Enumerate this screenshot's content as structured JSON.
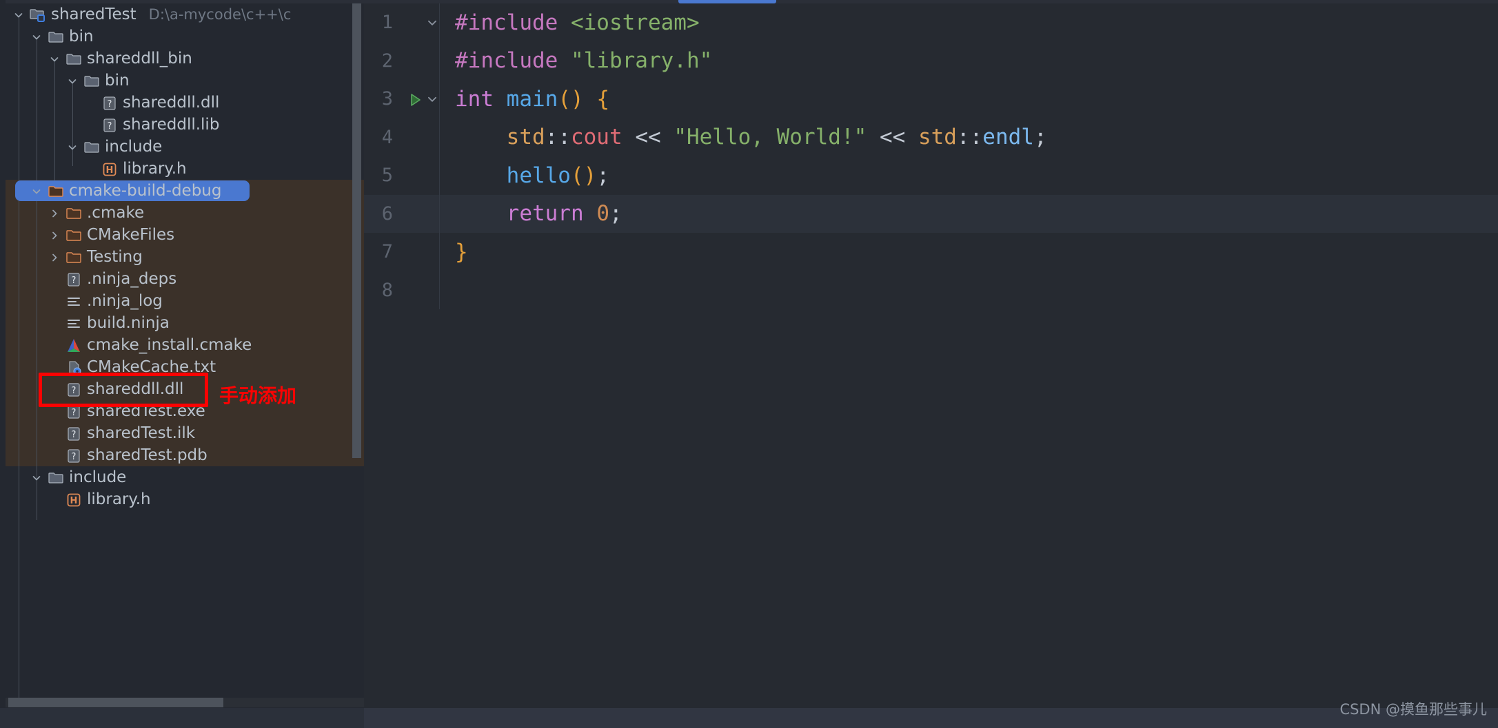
{
  "window": {
    "background": "#262a31",
    "accent": "#4a78d0",
    "excluded_background": "#3b3129",
    "annotation_color": "#fb0303"
  },
  "project_tree": {
    "root": {
      "label": "sharedTest",
      "path_hint": "D:\\a-mycode\\c++\\c",
      "icon": "project-module-folder-icon",
      "expanded": true
    },
    "nodes": [
      {
        "label": "sharedTest",
        "sublabel": "D:\\a-mycode\\c++\\c",
        "indent": 0,
        "type": "module",
        "icon": "project-module-folder-icon",
        "twisty": "down",
        "excluded": false,
        "selected": false
      },
      {
        "label": "bin",
        "sublabel": "",
        "indent": 1,
        "type": "folder",
        "icon": "folder-icon",
        "twisty": "down",
        "excluded": false,
        "selected": false
      },
      {
        "label": "shareddll_bin",
        "sublabel": "",
        "indent": 2,
        "type": "folder",
        "icon": "folder-icon",
        "twisty": "down",
        "excluded": false,
        "selected": false
      },
      {
        "label": "bin",
        "sublabel": "",
        "indent": 3,
        "type": "folder",
        "icon": "folder-icon",
        "twisty": "down",
        "excluded": false,
        "selected": false
      },
      {
        "label": "shareddll.dll",
        "sublabel": "",
        "indent": 4,
        "type": "file",
        "icon": "unknown-file-icon",
        "twisty": "none",
        "excluded": false,
        "selected": false
      },
      {
        "label": "shareddll.lib",
        "sublabel": "",
        "indent": 4,
        "type": "file",
        "icon": "unknown-file-icon",
        "twisty": "none",
        "excluded": false,
        "selected": false
      },
      {
        "label": "include",
        "sublabel": "",
        "indent": 3,
        "type": "folder",
        "icon": "folder-icon",
        "twisty": "down",
        "excluded": false,
        "selected": false
      },
      {
        "label": "library.h",
        "sublabel": "",
        "indent": 4,
        "type": "file",
        "icon": "header-file-icon",
        "twisty": "none",
        "excluded": false,
        "selected": false
      },
      {
        "label": "cmake-build-debug",
        "sublabel": "",
        "indent": 1,
        "type": "folder",
        "icon": "excluded-folder-icon",
        "twisty": "down",
        "excluded": true,
        "selected": true
      },
      {
        "label": ".cmake",
        "sublabel": "",
        "indent": 2,
        "type": "folder",
        "icon": "excluded-folder-icon",
        "twisty": "right",
        "excluded": true,
        "selected": false
      },
      {
        "label": "CMakeFiles",
        "sublabel": "",
        "indent": 2,
        "type": "folder",
        "icon": "excluded-folder-icon",
        "twisty": "right",
        "excluded": true,
        "selected": false
      },
      {
        "label": "Testing",
        "sublabel": "",
        "indent": 2,
        "type": "folder",
        "icon": "excluded-folder-icon",
        "twisty": "right",
        "excluded": true,
        "selected": false
      },
      {
        "label": ".ninja_deps",
        "sublabel": "",
        "indent": 2,
        "type": "file",
        "icon": "unknown-file-icon",
        "twisty": "none",
        "excluded": true,
        "selected": false
      },
      {
        "label": ".ninja_log",
        "sublabel": "",
        "indent": 2,
        "type": "file",
        "icon": "text-file-icon",
        "twisty": "none",
        "excluded": true,
        "selected": false
      },
      {
        "label": "build.ninja",
        "sublabel": "",
        "indent": 2,
        "type": "file",
        "icon": "text-file-icon",
        "twisty": "none",
        "excluded": true,
        "selected": false
      },
      {
        "label": "cmake_install.cmake",
        "sublabel": "",
        "indent": 2,
        "type": "file",
        "icon": "cmake-file-icon",
        "twisty": "none",
        "excluded": true,
        "selected": false
      },
      {
        "label": "CMakeCache.txt",
        "sublabel": "",
        "indent": 2,
        "type": "file",
        "icon": "cmake-cache-file-icon",
        "twisty": "none",
        "excluded": true,
        "selected": false
      },
      {
        "label": "shareddll.dll",
        "sublabel": "",
        "indent": 2,
        "type": "file",
        "icon": "unknown-file-icon",
        "twisty": "none",
        "excluded": true,
        "selected": false,
        "annotated": true
      },
      {
        "label": "sharedTest.exe",
        "sublabel": "",
        "indent": 2,
        "type": "file",
        "icon": "unknown-file-icon",
        "twisty": "none",
        "excluded": true,
        "selected": false
      },
      {
        "label": "sharedTest.ilk",
        "sublabel": "",
        "indent": 2,
        "type": "file",
        "icon": "unknown-file-icon",
        "twisty": "none",
        "excluded": true,
        "selected": false
      },
      {
        "label": "sharedTest.pdb",
        "sublabel": "",
        "indent": 2,
        "type": "file",
        "icon": "unknown-file-icon",
        "twisty": "none",
        "excluded": true,
        "selected": false
      },
      {
        "label": "include",
        "sublabel": "",
        "indent": 1,
        "type": "folder",
        "icon": "folder-icon",
        "twisty": "down",
        "excluded": false,
        "selected": false
      },
      {
        "label": "library.h",
        "sublabel": "",
        "indent": 2,
        "type": "file",
        "icon": "header-file-icon",
        "twisty": "none",
        "excluded": false,
        "selected": false
      }
    ],
    "scrollbars": {
      "vertical": true,
      "horizontal": true
    }
  },
  "annotation": {
    "text": "手动添加",
    "target": "shareddll.dll"
  },
  "editor": {
    "language": "cpp",
    "current_line": 6,
    "run_marker_line": 3,
    "lines": [
      {
        "number": "1",
        "fold": "down",
        "run": false,
        "tokens": [
          {
            "t": "#include ",
            "c": "pre"
          },
          {
            "t": "<iostream>",
            "c": "str"
          }
        ]
      },
      {
        "number": "2",
        "fold": "none",
        "run": false,
        "tokens": [
          {
            "t": "#include ",
            "c": "pre"
          },
          {
            "t": "\"library.h\"",
            "c": "str"
          }
        ]
      },
      {
        "number": "3",
        "fold": "down",
        "run": true,
        "tokens": [
          {
            "t": "int",
            "c": "kw"
          },
          {
            "t": " ",
            "c": "plain"
          },
          {
            "t": "main",
            "c": "fn"
          },
          {
            "t": "()",
            "c": "par"
          },
          {
            "t": " ",
            "c": "plain"
          },
          {
            "t": "{",
            "c": "par"
          }
        ]
      },
      {
        "number": "4",
        "fold": "none",
        "run": false,
        "tokens": [
          {
            "t": "    ",
            "c": "plain"
          },
          {
            "t": "std",
            "c": "ns"
          },
          {
            "t": "::",
            "c": "op"
          },
          {
            "t": "cout",
            "c": "mem"
          },
          {
            "t": " ",
            "c": "plain"
          },
          {
            "t": "<<",
            "c": "op"
          },
          {
            "t": " ",
            "c": "plain"
          },
          {
            "t": "\"Hello, World!\"",
            "c": "str"
          },
          {
            "t": " ",
            "c": "plain"
          },
          {
            "t": "<<",
            "c": "op"
          },
          {
            "t": " ",
            "c": "plain"
          },
          {
            "t": "std",
            "c": "ns"
          },
          {
            "t": "::",
            "c": "op"
          },
          {
            "t": "endl",
            "c": "var"
          },
          {
            "t": ";",
            "c": "plain"
          }
        ]
      },
      {
        "number": "5",
        "fold": "none",
        "run": false,
        "tokens": [
          {
            "t": "    ",
            "c": "plain"
          },
          {
            "t": "hello",
            "c": "fn"
          },
          {
            "t": "()",
            "c": "par"
          },
          {
            "t": ";",
            "c": "plain"
          }
        ]
      },
      {
        "number": "6",
        "fold": "none",
        "run": false,
        "current": true,
        "tokens": [
          {
            "t": "    ",
            "c": "plain"
          },
          {
            "t": "return",
            "c": "kw"
          },
          {
            "t": " ",
            "c": "plain"
          },
          {
            "t": "0",
            "c": "num"
          },
          {
            "t": ";",
            "c": "plain"
          }
        ]
      },
      {
        "number": "7",
        "fold": "none",
        "run": false,
        "tokens": [
          {
            "t": "}",
            "c": "par"
          }
        ]
      },
      {
        "number": "8",
        "fold": "none",
        "run": false,
        "tokens": []
      }
    ]
  },
  "watermark": {
    "text": "CSDN @摸鱼那些事儿"
  }
}
